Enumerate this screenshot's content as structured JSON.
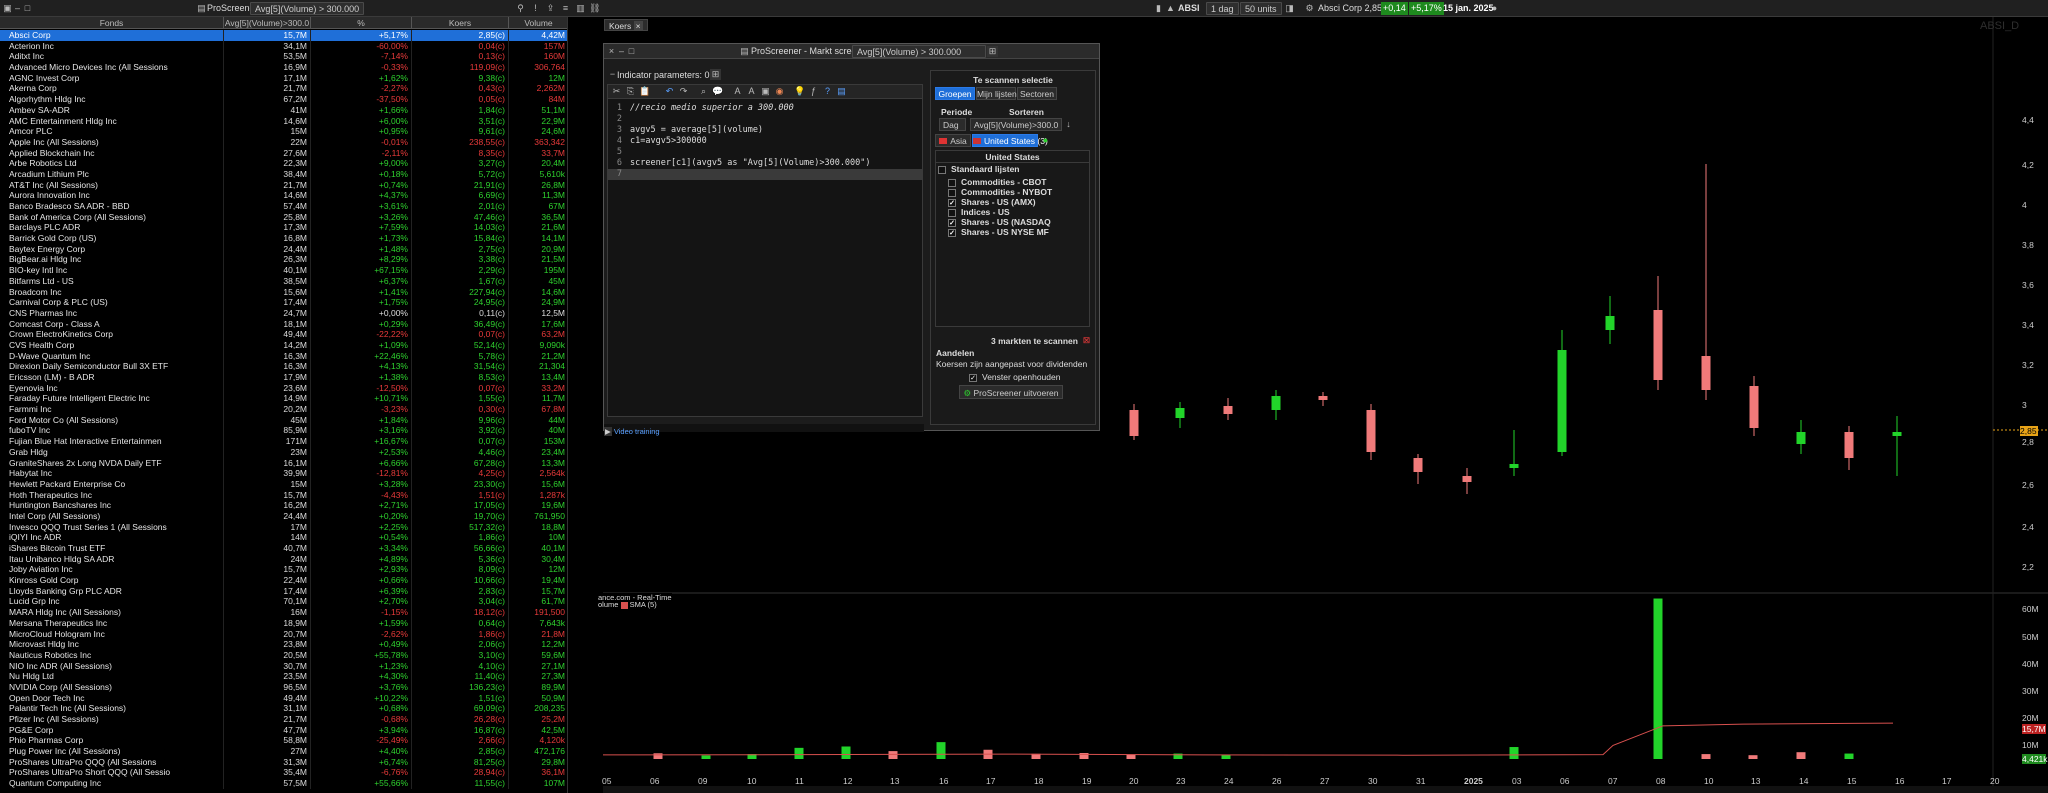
{
  "app": {
    "title": "ProScreener",
    "screener_select": "Avg[5](Volume) > 300.000"
  },
  "toolbar_right": {
    "symbol": "ABSI",
    "timeframe": "1 dag",
    "units": "50 units",
    "quote": "Absci Corp 2,85",
    "change_abs": "+0,14",
    "change_pct": "+5,17%",
    "date": "15 jan. 2025"
  },
  "table": {
    "headers": [
      "Fonds",
      "Avg[5](Volume)>300.0",
      "%",
      "Koers",
      "Volume"
    ],
    "rows": [
      [
        "Absci Corp",
        "15,7M",
        "+5,17%",
        "2,85(c)",
        "4,42M",
        "up",
        true
      ],
      [
        "Acterion Inc",
        "34,1M",
        "-60,00%",
        "0,04(c)",
        "157M",
        "dn",
        false
      ],
      [
        "Aditxt Inc",
        "53,5M",
        "-7,14%",
        "0,13(c)",
        "160M",
        "dn",
        false
      ],
      [
        "Advanced Micro Devices Inc (All Sessions",
        "16,9M",
        "-0,33%",
        "119,09(c)",
        "306,764",
        "dn",
        false
      ],
      [
        "AGNC Invest Corp",
        "17,1M",
        "+1,62%",
        "9,38(c)",
        "12M",
        "up",
        false
      ],
      [
        "Akerna Corp",
        "21,7M",
        "-2,27%",
        "0,43(c)",
        "2,262M",
        "dn",
        false
      ],
      [
        "Algorhythm Hldg Inc",
        "67,2M",
        "-37,50%",
        "0,05(c)",
        "84M",
        "dn",
        false
      ],
      [
        "Ambev SA-ADR",
        "41M",
        "+1,66%",
        "1,84(c)",
        "51,1M",
        "up",
        false
      ],
      [
        "AMC Entertainment Hldg Inc",
        "14,6M",
        "+6,00%",
        "3,51(c)",
        "22,9M",
        "up",
        false
      ],
      [
        "Amcor PLC",
        "15M",
        "+0,95%",
        "9,61(c)",
        "24,6M",
        "up",
        false
      ],
      [
        "Apple Inc (All Sessions)",
        "22M",
        "-0,01%",
        "238,55(c)",
        "363,342",
        "dn",
        false
      ],
      [
        "Applied Blockchain Inc",
        "27,6M",
        "-2,11%",
        "8,35(c)",
        "33,7M",
        "dn",
        false
      ],
      [
        "Arbe Robotics Ltd",
        "22,3M",
        "+9,00%",
        "3,27(c)",
        "20,4M",
        "up",
        false
      ],
      [
        "Arcadium Lithium Plc",
        "38,4M",
        "+0,18%",
        "5,72(c)",
        "5,610k",
        "up",
        false
      ],
      [
        "AT&T Inc (All Sessions)",
        "21,7M",
        "+0,74%",
        "21,91(c)",
        "26,8M",
        "up",
        false
      ],
      [
        "Aurora Innovation Inc",
        "14,6M",
        "+4,37%",
        "6,69(c)",
        "11,3M",
        "up",
        false
      ],
      [
        "Banco Bradesco SA ADR - BBD",
        "57,4M",
        "+3,61%",
        "2,01(c)",
        "67M",
        "up",
        false
      ],
      [
        "Bank of America Corp (All Sessions)",
        "25,8M",
        "+3,26%",
        "47,46(c)",
        "36,5M",
        "up",
        false
      ],
      [
        "Barclays PLC ADR",
        "17,3M",
        "+7,59%",
        "14,03(c)",
        "21,6M",
        "up",
        false
      ],
      [
        "Barrick Gold Corp (US)",
        "16,8M",
        "+1,73%",
        "15,84(c)",
        "14,1M",
        "up",
        false
      ],
      [
        "Baytex Energy Corp",
        "24,4M",
        "+1,48%",
        "2,75(c)",
        "20,9M",
        "up",
        false
      ],
      [
        "BigBear.ai Hldg Inc",
        "26,3M",
        "+8,29%",
        "3,38(c)",
        "21,5M",
        "up",
        false
      ],
      [
        "BIO-key Intl Inc",
        "40,1M",
        "+67,15%",
        "2,29(c)",
        "195M",
        "up",
        false
      ],
      [
        "Bitfarms Ltd - US",
        "38,5M",
        "+6,37%",
        "1,67(c)",
        "45M",
        "up",
        false
      ],
      [
        "Broadcom Inc",
        "15,6M",
        "+1,41%",
        "227,94(c)",
        "14,6M",
        "up",
        false
      ],
      [
        "Carnival Corp & PLC (US)",
        "17,4M",
        "+1,75%",
        "24,95(c)",
        "24,9M",
        "up",
        false
      ],
      [
        "CNS Pharmas Inc",
        "24,7M",
        "+0,00%",
        "0,11(c)",
        "12,5M",
        "nt",
        false
      ],
      [
        "Comcast Corp - Class A",
        "18,1M",
        "+0,29%",
        "36,49(c)",
        "17,6M",
        "up",
        false
      ],
      [
        "Crown ElectroKinetics Corp",
        "49,4M",
        "-22,22%",
        "0,07(c)",
        "63,2M",
        "dn",
        false
      ],
      [
        "CVS Health Corp",
        "14,2M",
        "+1,09%",
        "52,14(c)",
        "9,090k",
        "up",
        false
      ],
      [
        "D-Wave Quantum Inc",
        "16,3M",
        "+22,46%",
        "5,78(c)",
        "21,2M",
        "up",
        false
      ],
      [
        "Direxion Daily Semiconductor Bull 3X ETF",
        "16,3M",
        "+4,13%",
        "31,54(c)",
        "21,304",
        "up",
        false
      ],
      [
        "Ericsson (LM) - B ADR",
        "17,9M",
        "+1,38%",
        "8,53(c)",
        "13,4M",
        "up",
        false
      ],
      [
        "Eyenovia Inc",
        "23,6M",
        "-12,50%",
        "0,07(c)",
        "33,2M",
        "dn",
        false
      ],
      [
        "Faraday Future Intelligent Electric Inc",
        "14,9M",
        "+10,71%",
        "1,55(c)",
        "11,7M",
        "up",
        false
      ],
      [
        "Farmmi Inc",
        "20,2M",
        "-3,23%",
        "0,30(c)",
        "67,8M",
        "dn",
        false
      ],
      [
        "Ford Motor Co (All Sessions)",
        "45M",
        "+1,84%",
        "9,96(c)",
        "44M",
        "up",
        false
      ],
      [
        "fuboTV Inc",
        "85,9M",
        "+3,16%",
        "3,92(c)",
        "40M",
        "up",
        false
      ],
      [
        "Fujian Blue Hat Interactive Entertainmen",
        "171M",
        "+16,67%",
        "0,07(c)",
        "153M",
        "up",
        false
      ],
      [
        "Grab Hldg",
        "23M",
        "+2,53%",
        "4,46(c)",
        "23,4M",
        "up",
        false
      ],
      [
        "GraniteShares 2x Long NVDA Daily ETF",
        "16,1M",
        "+6,66%",
        "67,28(c)",
        "13,3M",
        "up",
        false
      ],
      [
        "Habytat Inc",
        "39,9M",
        "-12,81%",
        "4,25(c)",
        "2,564k",
        "dn",
        false
      ],
      [
        "Hewlett Packard Enterprise Co",
        "15M",
        "+3,28%",
        "23,30(c)",
        "15,6M",
        "up",
        false
      ],
      [
        "Hoth Therapeutics Inc",
        "15,7M",
        "-4,43%",
        "1,51(c)",
        "1,287k",
        "dn",
        false
      ],
      [
        "Huntington Bancshares Inc",
        "16,2M",
        "+2,71%",
        "17,05(c)",
        "19,6M",
        "up",
        false
      ],
      [
        "Intel Corp (All Sessions)",
        "24,4M",
        "+0,20%",
        "19,70(c)",
        "761,950",
        "up",
        false
      ],
      [
        "Invesco QQQ Trust Series 1 (All Sessions",
        "17M",
        "+2,25%",
        "517,32(c)",
        "18,8M",
        "up",
        false
      ],
      [
        "iQIYI Inc ADR",
        "14M",
        "+0,54%",
        "1,86(c)",
        "10M",
        "up",
        false
      ],
      [
        "iShares Bitcoin Trust ETF",
        "40,7M",
        "+3,34%",
        "56,66(c)",
        "40,1M",
        "up",
        false
      ],
      [
        "Itau Unibanco Hldg SA ADR",
        "24M",
        "+4,89%",
        "5,36(c)",
        "30,4M",
        "up",
        false
      ],
      [
        "Joby Aviation Inc",
        "15,7M",
        "+2,93%",
        "8,09(c)",
        "12M",
        "up",
        false
      ],
      [
        "Kinross Gold Corp",
        "22,4M",
        "+0,66%",
        "10,66(c)",
        "19,4M",
        "up",
        false
      ],
      [
        "Lloyds Banking Grp PLC ADR",
        "17,4M",
        "+6,39%",
        "2,83(c)",
        "15,7M",
        "up",
        false
      ],
      [
        "Lucid Grp Inc",
        "70,1M",
        "+2,70%",
        "3,04(c)",
        "61,7M",
        "up",
        false
      ],
      [
        "MARA Hldg Inc (All Sessions)",
        "16M",
        "-1,15%",
        "18,12(c)",
        "191,500",
        "dn",
        false
      ],
      [
        "Mersana Therapeutics Inc",
        "18,9M",
        "+1,59%",
        "0,64(c)",
        "7,643k",
        "up",
        false
      ],
      [
        "MicroCloud Hologram Inc",
        "20,7M",
        "-2,62%",
        "1,86(c)",
        "21,8M",
        "dn",
        false
      ],
      [
        "Microvast Hldg Inc",
        "23,8M",
        "+0,49%",
        "2,06(c)",
        "12,2M",
        "up",
        false
      ],
      [
        "Nauticus Robotics Inc",
        "20,5M",
        "+55,78%",
        "3,10(c)",
        "59,6M",
        "up",
        false
      ],
      [
        "NIO Inc ADR (All Sessions)",
        "30,7M",
        "+1,23%",
        "4,10(c)",
        "27,1M",
        "up",
        false
      ],
      [
        "Nu Hldg Ltd",
        "23,5M",
        "+4,30%",
        "11,40(c)",
        "27,3M",
        "up",
        false
      ],
      [
        "NVIDIA Corp (All Sessions)",
        "96,5M",
        "+3,76%",
        "136,23(c)",
        "89,9M",
        "up",
        false
      ],
      [
        "Open Door Tech Inc",
        "49,4M",
        "+10,22%",
        "1,51(c)",
        "50,9M",
        "up",
        false
      ],
      [
        "Palantir Tech Inc (All Sessions)",
        "31,1M",
        "+0,68%",
        "69,09(c)",
        "208,235",
        "up",
        false
      ],
      [
        "Pfizer Inc (All Sessions)",
        "21,7M",
        "-0,68%",
        "26,28(c)",
        "25,2M",
        "dn",
        false
      ],
      [
        "PG&E Corp",
        "47,7M",
        "+3,94%",
        "16,87(c)",
        "42,5M",
        "up",
        false
      ],
      [
        "Phio Pharmas Corp",
        "58,8M",
        "-25,49%",
        "2,66(c)",
        "4,120k",
        "dn",
        false
      ],
      [
        "Plug Power Inc (All Sessions)",
        "27M",
        "+4,40%",
        "2,85(c)",
        "472,176",
        "up",
        false
      ],
      [
        "ProShares UltraPro QQQ (All Sessions",
        "31,3M",
        "+6,74%",
        "81,25(c)",
        "29,8M",
        "up",
        false
      ],
      [
        "ProShares UltraPro Short QQQ (All Sessio",
        "35,4M",
        "-6,76%",
        "28,94(c)",
        "36,1M",
        "dn",
        false
      ],
      [
        "Quantum Computing Inc",
        "57,5M",
        "+55,66%",
        "11,55(c)",
        "107M",
        "up",
        false
      ]
    ]
  },
  "chart": {
    "tab_label": "Koers",
    "watermark": "ABSI_D",
    "price_axis": [
      "4,4",
      "4,2",
      "4",
      "3,8",
      "3,6",
      "3,4",
      "3,2",
      "3",
      "2,85",
      "2,8",
      "2,6",
      "2,4",
      "2,2"
    ],
    "volume_axis": [
      "60M",
      "50M",
      "40M",
      "30M",
      "20M",
      "15,7M",
      "10M",
      "4,421k"
    ],
    "volume_label": "olume",
    "sma_label": "SMA (5)",
    "source_text": "ance.com - Real-Time",
    "x_labels": [
      "05",
      "06",
      "09",
      "10",
      "11",
      "12",
      "13",
      "16",
      "17",
      "18",
      "19",
      "20",
      "23",
      "24",
      "26",
      "27",
      "30",
      "31",
      "2025",
      "03",
      "06",
      "07",
      "08",
      "10",
      "13",
      "14",
      "15",
      "16",
      "17",
      "20"
    ]
  },
  "screener": {
    "title": "ProScreener - Markt screening",
    "title_value": "Avg[5](Volume) > 300.000",
    "indicator_label": "Indicator parameters: 0",
    "code": [
      "//recio medio superior a 300.000",
      "",
      "avgv5 = average[5](volume)",
      "c1=avgv5>300000",
      "",
      "screener[c1](avgv5 as \"Avg[5](Volume)>300.000\")",
      ""
    ],
    "video_link": "Video training",
    "scan_title": "Te scannen selectie",
    "tabs": [
      "Groepen",
      "Mijn lijsten",
      "Sectoren"
    ],
    "period_label": "Periode",
    "sort_label": "Sorteren",
    "period_value": "Dag",
    "sort_value": "Avg[5](Volume)>300.0",
    "region_asia": "Asia",
    "region_us": "United States (3)",
    "region_header": "United States",
    "list_group": "Standaard lijsten",
    "markets": [
      {
        "label": "Commodities - CBOT",
        "checked": false
      },
      {
        "label": "Commodities - NYBOT",
        "checked": false
      },
      {
        "label": "Shares - US (AMX)",
        "checked": true
      },
      {
        "label": "Indices - US",
        "checked": false
      },
      {
        "label": "Shares - US (NASDAQ",
        "checked": true
      },
      {
        "label": "Shares - US NYSE MF",
        "checked": true
      }
    ],
    "markets_count": "3 markten te scannen",
    "shares_title": "Aandelen",
    "shares_note": "Koersen zijn aangepast voor dividenden",
    "keep_window": "Venster openhouden",
    "run_button": "ProScreener uitvoeren"
  },
  "candles": [
    {
      "o": 2.95,
      "c": 2.82,
      "h": 2.98,
      "l": 2.8
    },
    {
      "o": 2.91,
      "c": 2.96,
      "h": 2.99,
      "l": 2.86
    },
    {
      "o": 2.97,
      "c": 2.93,
      "h": 3.01,
      "l": 2.9
    },
    {
      "o": 2.95,
      "c": 3.02,
      "h": 3.05,
      "l": 2.9
    },
    {
      "o": 3.02,
      "c": 3.0,
      "h": 3.04,
      "l": 2.97
    },
    {
      "o": 2.95,
      "c": 2.74,
      "h": 2.98,
      "l": 2.7
    },
    {
      "o": 2.71,
      "c": 2.64,
      "h": 2.73,
      "l": 2.58
    },
    {
      "o": 2.62,
      "c": 2.59,
      "h": 2.66,
      "l": 2.53
    },
    {
      "o": 2.66,
      "c": 2.68,
      "h": 2.85,
      "l": 2.62
    },
    {
      "o": 2.74,
      "c": 3.25,
      "h": 3.35,
      "l": 2.72
    },
    {
      "o": 3.35,
      "c": 3.42,
      "h": 3.52,
      "l": 3.28
    },
    {
      "o": 3.45,
      "c": 3.1,
      "h": 3.62,
      "l": 3.05
    },
    {
      "o": 3.22,
      "c": 3.05,
      "h": 4.18,
      "l": 3.0
    },
    {
      "o": 3.07,
      "c": 2.86,
      "h": 3.12,
      "l": 2.82
    },
    {
      "o": 2.78,
      "c": 2.84,
      "h": 2.9,
      "l": 2.73
    },
    {
      "o": 2.84,
      "c": 2.71,
      "h": 2.87,
      "l": 2.65
    },
    {
      "o": 2.82,
      "c": 2.84,
      "h": 2.92,
      "l": 2.62
    }
  ],
  "volumes": [
    2.1,
    1.3,
    1.8,
    4.1,
    4.6,
    2.9,
    6.2,
    3.4,
    1.9,
    2.2,
    1.6,
    2.0,
    1.5,
    59,
    1.8,
    1.4,
    2.5,
    2.0,
    4.4
  ],
  "colors": {
    "accent": "#1f6fd8",
    "up": "#2ed12e",
    "down": "#e83a3a",
    "bull_candle": "#22d42a",
    "bear_candle": "#f07a7a",
    "sma": "#d8504e"
  }
}
